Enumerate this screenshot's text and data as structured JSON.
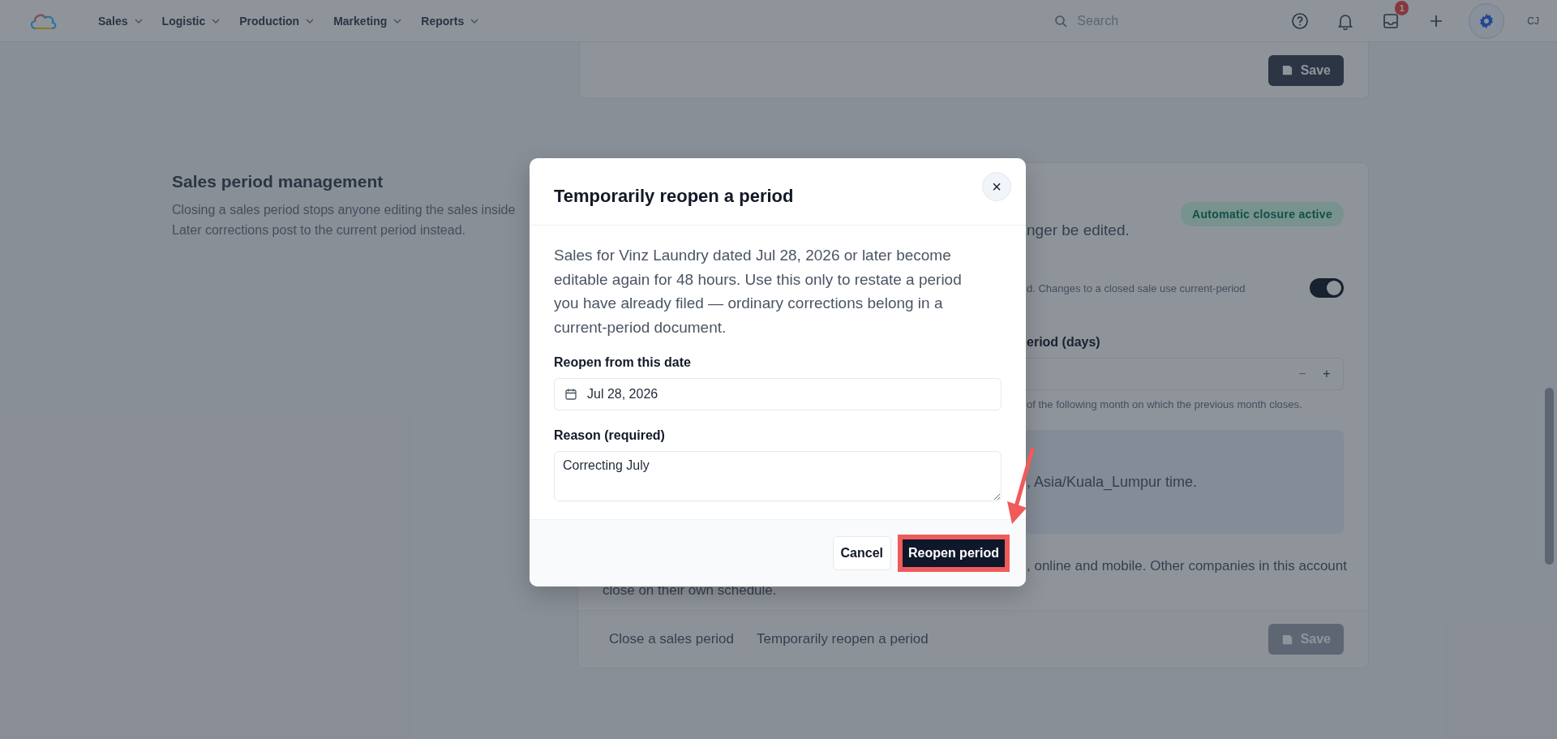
{
  "nav": {
    "items": [
      {
        "label": "Sales"
      },
      {
        "label": "Logistic"
      },
      {
        "label": "Production"
      },
      {
        "label": "Marketing"
      },
      {
        "label": "Reports"
      }
    ],
    "search": {
      "placeholder": "Search"
    },
    "inbox_badge": "1",
    "user_initials": "CJ"
  },
  "top_card": {
    "save": {
      "label": "Save",
      "disabled": false
    }
  },
  "section": {
    "title": "Sales period management",
    "description_lines": [
      "Closing a sales period stops anyone editing the sales inside",
      "Later corrections post to the current period instead."
    ]
  },
  "card": {
    "intro_fragment": "nger be edited.",
    "badge": "Automatic closure active",
    "toggle": {
      "text": "d. Changes to a closed sale use current-period",
      "on": true
    },
    "days_label": "eriod (days)",
    "stepper": {
      "minus": "−",
      "plus": "+",
      "minus_disabled": true
    },
    "days_help": "of the following month on which the previous month closes.",
    "info_fragment": ", Asia/Kuala_Lumpur time.",
    "scope_line_1": ", online and mobile. Other companies in this account",
    "scope_line_2": "close on their own schedule.",
    "actions": [
      {
        "label": "Close a sales period"
      },
      {
        "label": "Temporarily reopen a period"
      }
    ],
    "save": {
      "label": "Save",
      "disabled": true
    }
  },
  "modal": {
    "title": "Temporarily reopen a period",
    "close": "×",
    "body": "Sales for Vinz Laundry dated Jul 28, 2026 or later become editable again for 48 hours. Use this only to restate a period you have already filed — ordinary corrections belong in a current-period document.",
    "date_label": "Reopen from this date",
    "date_value": "Jul 28, 2026",
    "reason_label": "Reason (required)",
    "reason_value": "Correcting July",
    "cancel": "Cancel",
    "confirm": "Reopen period",
    "confirm_highlighted": true
  }
}
